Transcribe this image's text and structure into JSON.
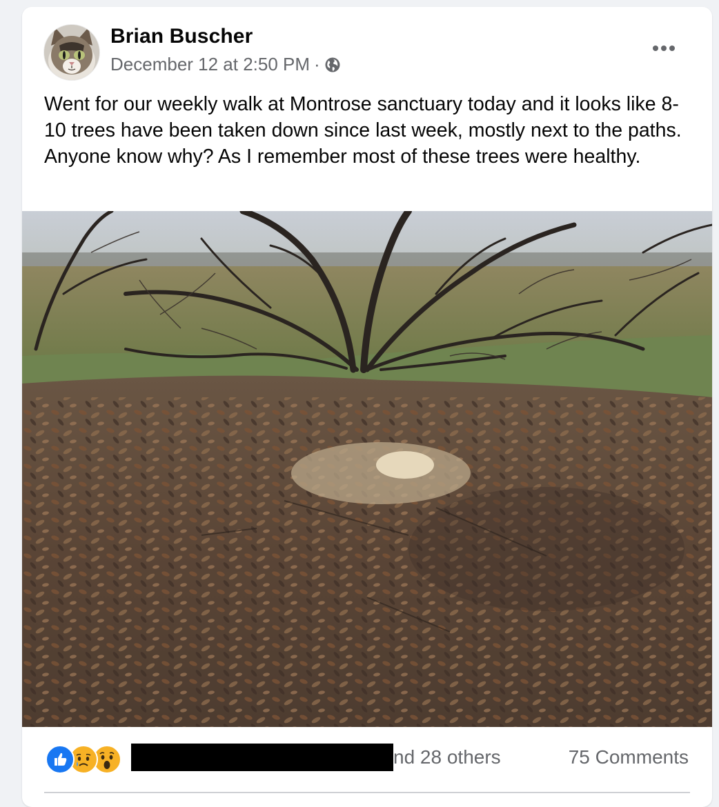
{
  "post": {
    "author": "Brian Buscher",
    "timestamp": "December 12 at 2:50 PM",
    "separator": "·",
    "privacy_icon": "globe-icon",
    "more_icon": "more-horizontal-icon",
    "text": "Went for our weekly walk at Montrose sanctuary today and it looks like 8-10 trees have been taken down since last week, mostly next to the paths. Anyone know why? As I remember most of these trees were healthy."
  },
  "reactions": {
    "icons": [
      "like-reaction-icon",
      "sad-reaction-icon",
      "wow-reaction-icon"
    ],
    "others_text": "nd 28 others",
    "comments_text": "75 Comments"
  },
  "colors": {
    "background": "#f0f2f5",
    "card": "#ffffff",
    "secondary_text": "#65676b",
    "like_blue": "#1877f2",
    "reaction_yellow": "#f7b125"
  }
}
